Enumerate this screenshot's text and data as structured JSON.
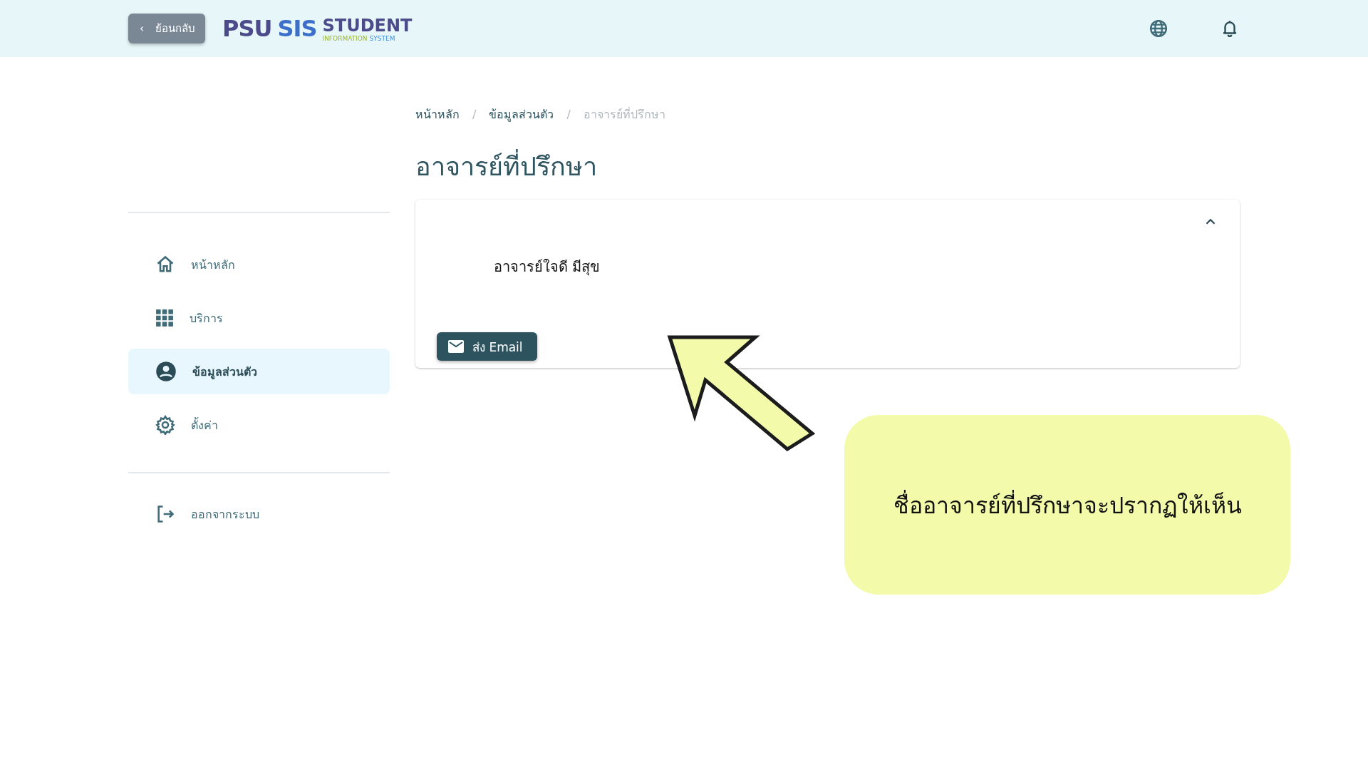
{
  "header": {
    "back_button": {
      "icon": "‹",
      "label": "ย้อนกลับ"
    },
    "logo": {
      "psu": "PSU",
      "sis": "SIS",
      "student": "STUDENT",
      "information": "INFORMATION",
      "system": "SYSTEM"
    }
  },
  "sidebar": {
    "items": [
      {
        "kind": "home",
        "label": "หน้าหลัก",
        "selected": false
      },
      {
        "kind": "grid",
        "label": "บริการ",
        "selected": false
      },
      {
        "kind": "person",
        "label": "ข้อมูลส่วนตัว",
        "selected": true
      },
      {
        "kind": "gear",
        "label": "ตั้งค่า",
        "selected": false
      }
    ],
    "logout": {
      "label": "ออกจากระบบ"
    }
  },
  "breadcrumb": [
    {
      "label": "หน้าหลัก",
      "current": false
    },
    {
      "separator": "/",
      "label": "ข้อมูลส่วนตัว",
      "current": false
    },
    {
      "separator": "/",
      "label": "อาจารย์ที่ปรึกษา",
      "current": true
    }
  ],
  "title": "อาจารย์ที่ปรึกษา",
  "advisor_card": {
    "expanded": true,
    "name": "อาจารย์ใจดี มีสุข",
    "email_button": "ส่ง Email"
  },
  "callout": {
    "text": "ชื่ออาจารย์ที่ปรึกษาจะปรากฏให้เห็น"
  }
}
